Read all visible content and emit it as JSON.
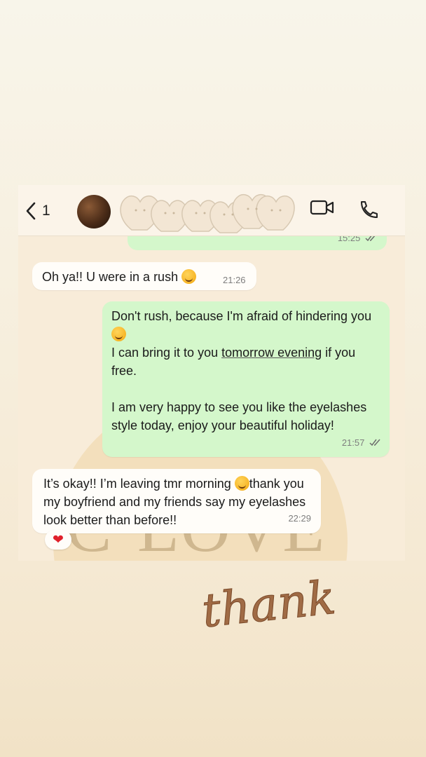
{
  "header": {
    "back_count": "1",
    "contact_name": ""
  },
  "messages": {
    "prev_out_time": "15:25",
    "m1": {
      "text": "Oh ya!! U were in a rush",
      "time": "21:26"
    },
    "m2": {
      "line1": "Don't rush, because I'm afraid of hindering you",
      "line2_pre": "I can bring it to you ",
      "line2_link": "tomorrow evening",
      "line2_post": " if you free.",
      "para2": "I am very happy to see you like the eyelashes style today, enjoy your beautiful holiday!",
      "time": "21:57"
    },
    "m3": {
      "text_pre": "It’s okay!! I’m leaving tmr morning ",
      "text_post": "thank you my boyfriend and my friends say my eyelashes look better than before!!",
      "time": "22:29",
      "reaction": "❤"
    }
  },
  "overlay": {
    "watermark": "C·LOVE",
    "sticker": "thank"
  },
  "colors": {
    "outgoing": "#d4f7cb",
    "incoming": "#fffdf9",
    "heart": "#e0202a",
    "sticker": "#a06b45"
  },
  "icons": [
    "chevron-left-icon",
    "video-call-icon",
    "phone-icon",
    "double-check-icon",
    "emoji-rofl-icon",
    "emoji-hush-icon"
  ]
}
